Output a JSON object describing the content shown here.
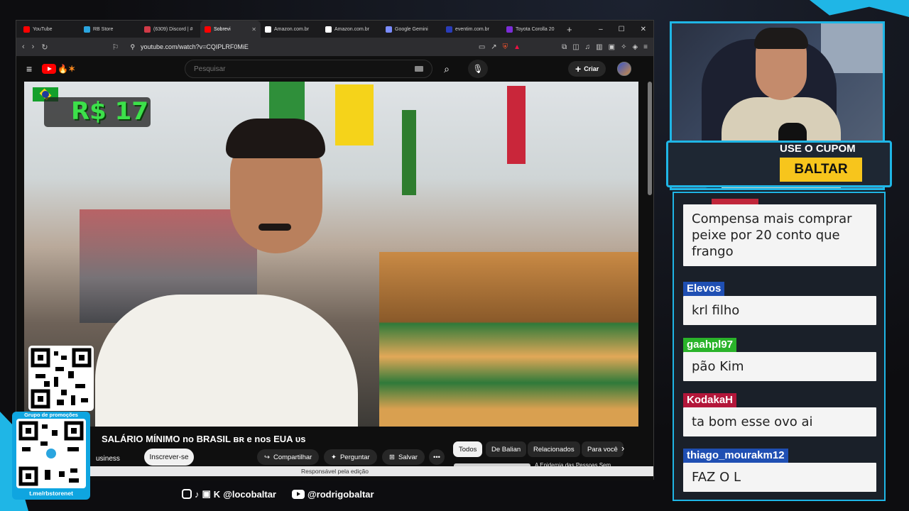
{
  "browser": {
    "tabs": [
      {
        "label": "YouTube",
        "fav": "#ff0000"
      },
      {
        "label": "RB Store",
        "fav": "#2aa5df"
      },
      {
        "label": "(6309) Discord | #",
        "fav": "#d13b48"
      },
      {
        "label": "Sobrevi",
        "fav": "#ff0000",
        "active": true
      },
      {
        "label": "Amazon.com.br",
        "fav": "#ffffff"
      },
      {
        "label": "Amazon.com.br",
        "fav": "#ffffff"
      },
      {
        "label": "Google Gemini",
        "fav": "#7b8cff"
      },
      {
        "label": "eventim.com.br",
        "fav": "#2a3cb8"
      },
      {
        "label": "Toyota Corolla 20",
        "fav": "#7b2dd8"
      }
    ],
    "url": "youtube.com/watch?v=CQIPLRF0MiE",
    "window_controls": {
      "minimize": "–",
      "maximize": "☐",
      "close": "✕"
    }
  },
  "youtube": {
    "search_placeholder": "Pesquisar",
    "create_label": "Criar",
    "video_overlay_price": "R$ 17",
    "video_title": "SALÁRIO MÍNIMO no BRASIL ʙʀ e nos EUA ᴜs",
    "channel_fragment": "usiness",
    "subscribe_label": "Inscrever-se",
    "actions": {
      "share": "Compartilhar",
      "ask": "Perguntar",
      "save": "Salvar",
      "more": "•••"
    },
    "chips": [
      "Todos",
      "De Balian",
      "Relacionados",
      "Para você"
    ],
    "recommendation_title": "A Epidemia das Pessoas Sem",
    "edit_notice": "Responsável pela edição"
  },
  "overlay": {
    "qr_promo_label": "Grupo de promoções",
    "qr_link": "t.me/rbstorenet",
    "instagram_handle": "@locobaltar",
    "youtube_handle": "@rodrigobaltar",
    "coupon_title": "USE O CUPOM",
    "coupon_code": "BALTAR"
  },
  "chat": {
    "messages": [
      {
        "user": "",
        "color": "#c0263a",
        "text": "Compensa mais comprar peixe por 20 conto que frango"
      },
      {
        "user": "Elevos",
        "color": "#1f4fb3",
        "text": "krl filho"
      },
      {
        "user": "gaahpl97",
        "color": "#2ab32a",
        "text": "pão Kim"
      },
      {
        "user": "KodakaH",
        "color": "#b3163a",
        "text": "ta bom esse ovo ai"
      },
      {
        "user": "thiago_mourakm12",
        "color": "#1f4fb3",
        "text": "FAZ O L"
      }
    ]
  },
  "colors": {
    "accent": "#1fb6e6",
    "coupon": "#f7c51c",
    "price_green": "#3ce04a",
    "youtube_red": "#ff0000"
  }
}
